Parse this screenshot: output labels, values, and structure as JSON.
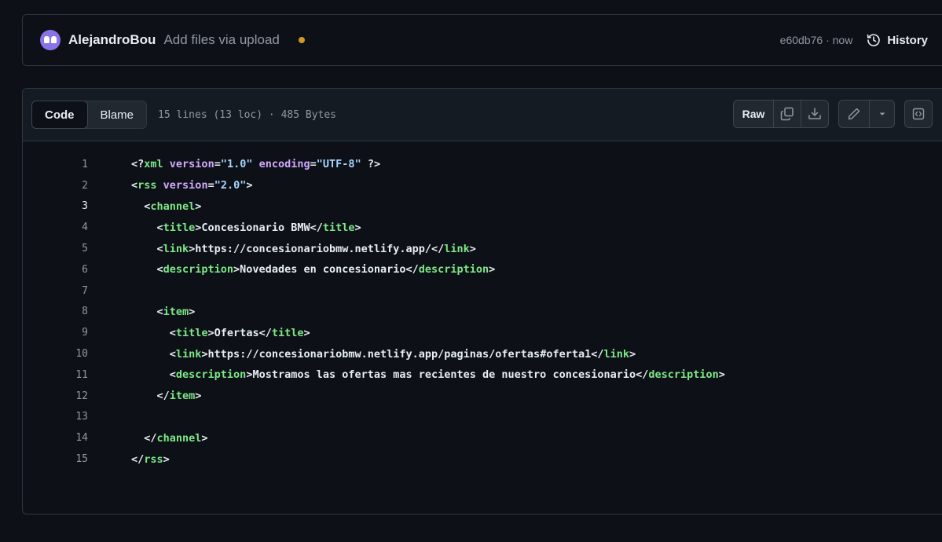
{
  "commit": {
    "author": "AlejandroBou",
    "message": "Add files via upload",
    "sha_time": "e60db76 · now",
    "history_label": "History"
  },
  "file": {
    "tabs": [
      "Code",
      "Blame"
    ],
    "meta": "15 lines (13 loc) · 485 Bytes",
    "raw_label": "Raw",
    "icons": [
      "copy-icon",
      "download-icon",
      "pencil-icon",
      "caret-down-icon",
      "symbols-icon"
    ]
  },
  "colors": {
    "bg": "#0d1117",
    "tag": "#7ee787",
    "attr": "#d2a8ff",
    "string": "#a5d6ff",
    "status": "#d29922"
  },
  "code": {
    "numbers": [
      "1",
      "2",
      "3",
      "4",
      "5",
      "6",
      "7",
      "8",
      "9",
      "10",
      "11",
      "12",
      "13",
      "14",
      "15"
    ],
    "lines": [
      [
        {
          "t": "<?",
          "c": "p"
        },
        {
          "t": "xml",
          "c": "tg"
        },
        {
          "t": " ",
          "c": "p"
        },
        {
          "t": "version",
          "c": "at"
        },
        {
          "t": "=",
          "c": "p"
        },
        {
          "t": "\"1.0\"",
          "c": "st"
        },
        {
          "t": " ",
          "c": "p"
        },
        {
          "t": "encoding",
          "c": "at"
        },
        {
          "t": "=",
          "c": "p"
        },
        {
          "t": "\"UTF-8\"",
          "c": "st"
        },
        {
          "t": " ?>",
          "c": "p"
        }
      ],
      [
        {
          "t": "<",
          "c": "p"
        },
        {
          "t": "rss",
          "c": "tg"
        },
        {
          "t": " ",
          "c": "p"
        },
        {
          "t": "version",
          "c": "at"
        },
        {
          "t": "=",
          "c": "p"
        },
        {
          "t": "\"2.0\"",
          "c": "st"
        },
        {
          "t": ">",
          "c": "p"
        }
      ],
      [
        {
          "t": "  <",
          "c": "p"
        },
        {
          "t": "channel",
          "c": "tg"
        },
        {
          "t": ">",
          "c": "p"
        }
      ],
      [
        {
          "t": "    <",
          "c": "p"
        },
        {
          "t": "title",
          "c": "tg"
        },
        {
          "t": ">Concesionario BMW</",
          "c": "p"
        },
        {
          "t": "title",
          "c": "tg"
        },
        {
          "t": ">",
          "c": "p"
        }
      ],
      [
        {
          "t": "    <",
          "c": "p"
        },
        {
          "t": "link",
          "c": "tg"
        },
        {
          "t": ">https://concesionariobmw.netlify.app/</",
          "c": "p"
        },
        {
          "t": "link",
          "c": "tg"
        },
        {
          "t": ">",
          "c": "p"
        }
      ],
      [
        {
          "t": "    <",
          "c": "p"
        },
        {
          "t": "description",
          "c": "tg"
        },
        {
          "t": ">Novedades en concesionario</",
          "c": "p"
        },
        {
          "t": "description",
          "c": "tg"
        },
        {
          "t": ">",
          "c": "p"
        }
      ],
      [],
      [
        {
          "t": "    <",
          "c": "p"
        },
        {
          "t": "item",
          "c": "tg"
        },
        {
          "t": ">",
          "c": "p"
        }
      ],
      [
        {
          "t": "      <",
          "c": "p"
        },
        {
          "t": "title",
          "c": "tg"
        },
        {
          "t": ">Ofertas</",
          "c": "p"
        },
        {
          "t": "title",
          "c": "tg"
        },
        {
          "t": ">",
          "c": "p"
        }
      ],
      [
        {
          "t": "      <",
          "c": "p"
        },
        {
          "t": "link",
          "c": "tg"
        },
        {
          "t": ">https://concesionariobmw.netlify.app/paginas/ofertas#oferta1</",
          "c": "p"
        },
        {
          "t": "link",
          "c": "tg"
        },
        {
          "t": ">",
          "c": "p"
        }
      ],
      [
        {
          "t": "      <",
          "c": "p"
        },
        {
          "t": "description",
          "c": "tg"
        },
        {
          "t": ">Mostramos las ofertas mas recientes de nuestro concesionario</",
          "c": "p"
        },
        {
          "t": "description",
          "c": "tg"
        },
        {
          "t": ">",
          "c": "p"
        }
      ],
      [
        {
          "t": "    </",
          "c": "p"
        },
        {
          "t": "item",
          "c": "tg"
        },
        {
          "t": ">",
          "c": "p"
        }
      ],
      [],
      [
        {
          "t": "  </",
          "c": "p"
        },
        {
          "t": "channel",
          "c": "tg"
        },
        {
          "t": ">",
          "c": "p"
        }
      ],
      [
        {
          "t": "</",
          "c": "p"
        },
        {
          "t": "rss",
          "c": "tg"
        },
        {
          "t": ">",
          "c": "p"
        }
      ]
    ]
  }
}
